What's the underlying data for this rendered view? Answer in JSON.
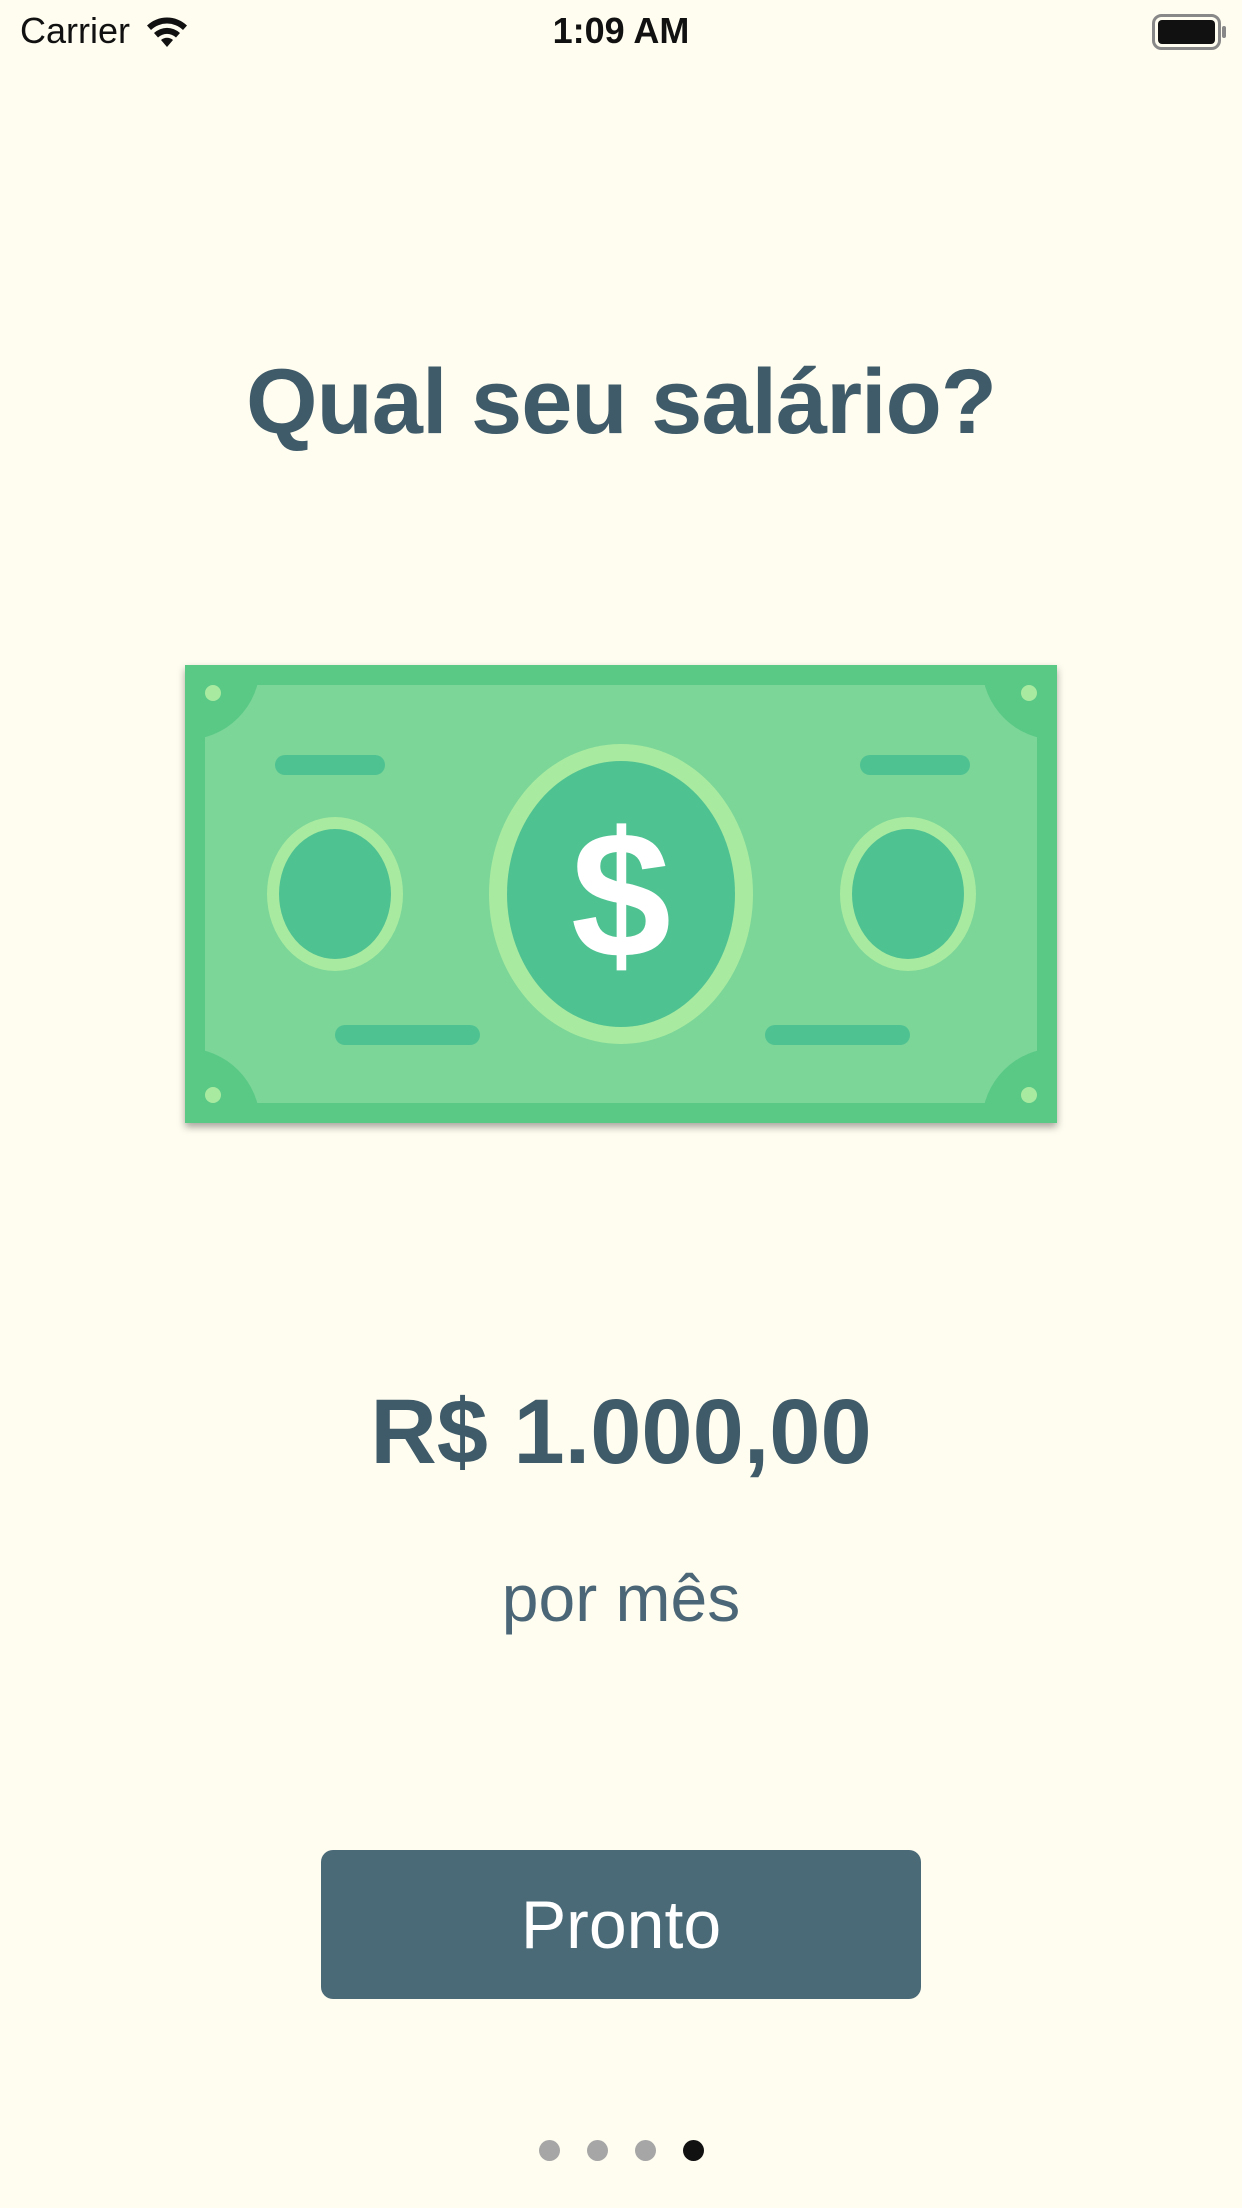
{
  "status_bar": {
    "carrier": "Carrier",
    "time": "1:09 AM",
    "icons": [
      "wifi-icon",
      "battery-icon"
    ]
  },
  "screen": {
    "title": "Qual seu salário?",
    "illustration": "money-bill-icon",
    "illustration_symbol": "$",
    "amount": "R$ 1.000,00",
    "period": "por mês",
    "button_label": "Pronto"
  },
  "pagination": {
    "total": 4,
    "current": 4
  },
  "colors": {
    "background": "#FFFDF0",
    "text_primary": "#3F5A69",
    "button": "#4A6A78",
    "bill_outer": "#5AC986",
    "bill_inner": "#7BD698",
    "bill_dark": "#4FC292",
    "bill_light": "#A8EAA0"
  }
}
